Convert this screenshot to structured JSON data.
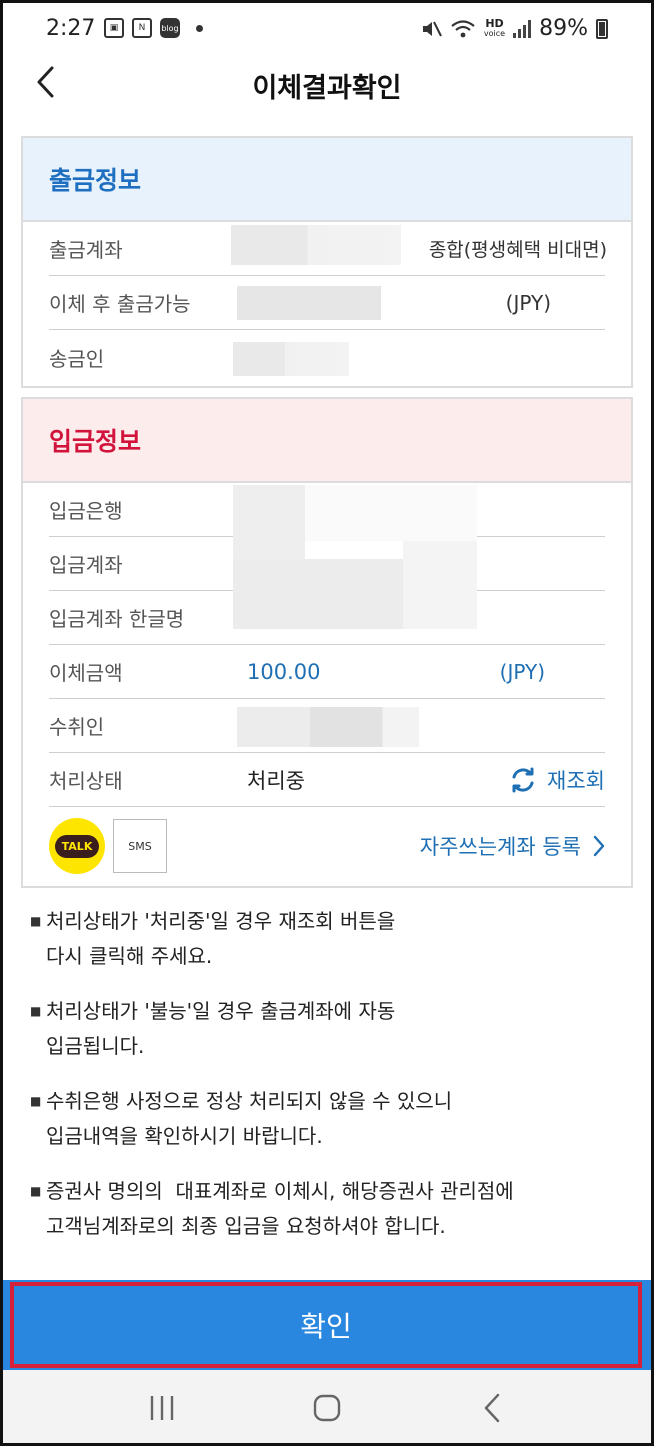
{
  "status_bar": {
    "time": "2:27",
    "battery": "89%",
    "left_icons": [
      "gallery-icon",
      "n-icon",
      "blog-icon"
    ],
    "blog_label": "blog",
    "hd_label": "HD",
    "voice_label": "voice"
  },
  "header": {
    "title": "이체결과확인"
  },
  "withdrawal": {
    "title": "출금정보",
    "rows": {
      "account": {
        "label": "출금계좌",
        "extra": "종합(평생혜택 비대면)"
      },
      "available": {
        "label": "이체 후 출금가능",
        "unit": "(JPY)"
      },
      "sender": {
        "label": "송금인"
      }
    }
  },
  "deposit": {
    "title": "입금정보",
    "rows": {
      "bank": {
        "label": "입금은행"
      },
      "account": {
        "label": "입금계좌"
      },
      "holder": {
        "label": "입금계좌 한글명"
      },
      "amount": {
        "label": "이체금액",
        "value": "100.00",
        "unit": "(JPY)"
      },
      "recipient": {
        "label": "수취인"
      },
      "status": {
        "label": "처리상태",
        "value": "처리중",
        "requery_label": "재조회"
      }
    },
    "share": {
      "talk_label": "TALK",
      "sms_label": "SMS",
      "favorite_label": "자주쓰는계좌 등록"
    }
  },
  "notes": [
    {
      "lines": [
        "처리상태가 '처리중'일 경우 재조회 버튼을",
        "다시 클릭해 주세요."
      ]
    },
    {
      "lines": [
        "처리상태가 '불능'일 경우 출금계좌에 자동",
        "입금됩니다."
      ]
    },
    {
      "lines": [
        "수취은행 사정으로 정상 처리되지 않을 수 있으니",
        "입금내역을 확인하시기 바랍니다."
      ]
    },
    {
      "lines": [
        "증권사 명의의  대표계좌로 이체시, 해당증권사 관리점에",
        "고객님계좌로의 최종 입금을 요청하셔야 합니다."
      ]
    }
  ],
  "confirm": {
    "label": "확인"
  },
  "colors": {
    "accent": "#2a87e0",
    "link": "#1f6fb4",
    "deposit_title": "#d2143c",
    "withdraw_title": "#1f6fc0"
  }
}
